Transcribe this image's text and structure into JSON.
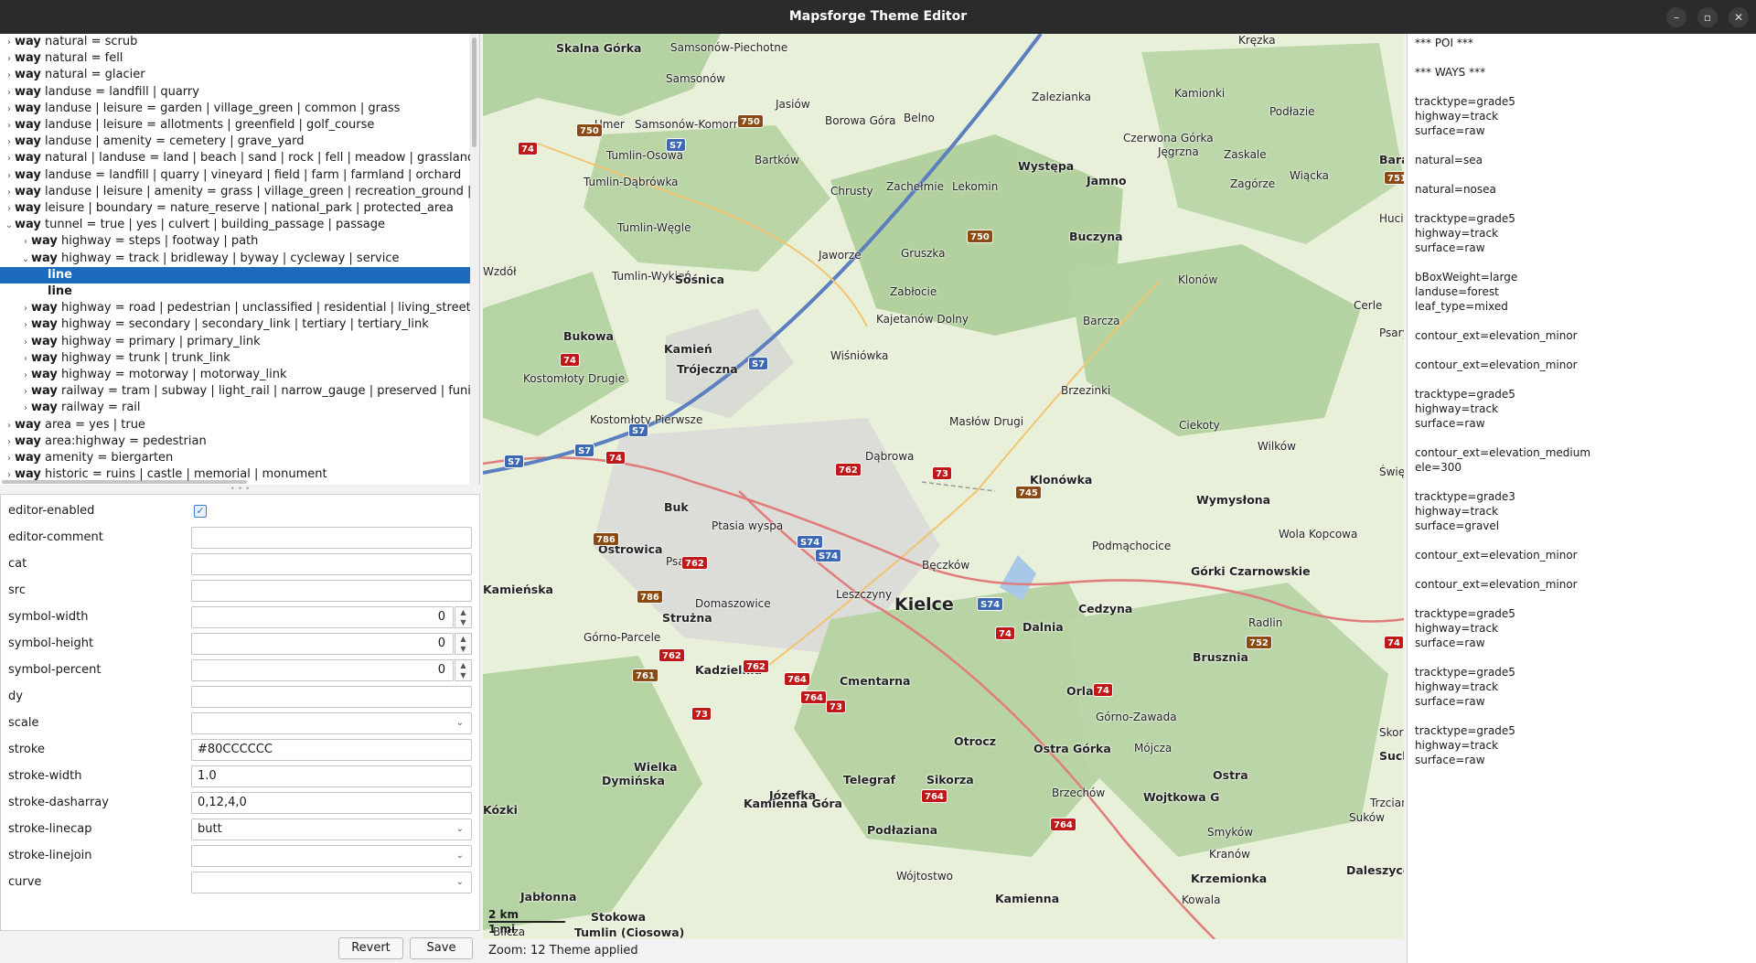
{
  "window": {
    "title": "Mapsforge Theme Editor",
    "controls": {
      "minimize": "–",
      "maximize": "▫",
      "close": "✕"
    }
  },
  "tree": {
    "rows": [
      {
        "chev": "›",
        "kw": "way",
        "text": " natural = scrub",
        "indent": 0
      },
      {
        "chev": "›",
        "kw": "way",
        "text": " natural = fell",
        "indent": 0
      },
      {
        "chev": "›",
        "kw": "way",
        "text": " natural = glacier",
        "indent": 0
      },
      {
        "chev": "›",
        "kw": "way",
        "text": " landuse = landfill | quarry",
        "indent": 0
      },
      {
        "chev": "›",
        "kw": "way",
        "text": " landuse | leisure = garden | village_green | common | grass",
        "indent": 0
      },
      {
        "chev": "›",
        "kw": "way",
        "text": " landuse | leisure = allotments | greenfield | golf_course",
        "indent": 0
      },
      {
        "chev": "›",
        "kw": "way",
        "text": " landuse | amenity = cemetery | grave_yard",
        "indent": 0
      },
      {
        "chev": "›",
        "kw": "way",
        "text": " natural | landuse = land | beach | sand | rock | fell | meadow | grassland | heath |",
        "indent": 0
      },
      {
        "chev": "›",
        "kw": "way",
        "text": " landuse = landfill | quarry | vineyard | field | farm | farmland | orchard",
        "indent": 0
      },
      {
        "chev": "›",
        "kw": "way",
        "text": " landuse | leisure | amenity = grass | village_green | recreation_ground | military |",
        "indent": 0
      },
      {
        "chev": "›",
        "kw": "way",
        "text": " leisure | boundary = nature_reserve | national_park | protected_area",
        "indent": 0
      },
      {
        "chev": "⌄",
        "kw": "way",
        "text": " tunnel = true | yes | culvert | building_passage | passage",
        "indent": 0
      },
      {
        "chev": "›",
        "kw": "way",
        "text": " highway = steps | footway | path",
        "indent": 1
      },
      {
        "chev": "⌄",
        "kw": "way",
        "text": " highway = track | bridleway | byway | cycleway | service",
        "indent": 1
      },
      {
        "chev": "",
        "kw": "line",
        "text": "",
        "indent": 2,
        "selected": true
      },
      {
        "chev": "",
        "kw": "line",
        "text": "",
        "indent": 2
      },
      {
        "chev": "›",
        "kw": "way",
        "text": " highway = road | pedestrian | unclassified | residential | living_street | construc",
        "indent": 1
      },
      {
        "chev": "›",
        "kw": "way",
        "text": " highway = secondary | secondary_link | tertiary | tertiary_link",
        "indent": 1
      },
      {
        "chev": "›",
        "kw": "way",
        "text": " highway = primary | primary_link",
        "indent": 1
      },
      {
        "chev": "›",
        "kw": "way",
        "text": " highway = trunk | trunk_link",
        "indent": 1
      },
      {
        "chev": "›",
        "kw": "way",
        "text": " highway = motorway | motorway_link",
        "indent": 1
      },
      {
        "chev": "›",
        "kw": "way",
        "text": " railway = tram | subway | light_rail | narrow_gauge | preserved | funicular | min",
        "indent": 1
      },
      {
        "chev": "›",
        "kw": "way",
        "text": " railway = rail",
        "indent": 1
      },
      {
        "chev": "›",
        "kw": "way",
        "text": " area = yes | true",
        "indent": 0
      },
      {
        "chev": "›",
        "kw": "way",
        "text": " area:highway = pedestrian",
        "indent": 0
      },
      {
        "chev": "›",
        "kw": "way",
        "text": " amenity = biergarten",
        "indent": 0
      },
      {
        "chev": "›",
        "kw": "way",
        "text": " historic = ruins | castle | memorial | monument",
        "indent": 0
      }
    ]
  },
  "props": {
    "editor_enabled": {
      "label": "editor-enabled",
      "checked": true,
      "mark": "✓"
    },
    "editor_comment": {
      "label": "editor-comment",
      "value": ""
    },
    "cat": {
      "label": "cat",
      "value": ""
    },
    "src": {
      "label": "src",
      "value": ""
    },
    "symbol_width": {
      "label": "symbol-width",
      "value": "0"
    },
    "symbol_height": {
      "label": "symbol-height",
      "value": "0"
    },
    "symbol_percent": {
      "label": "symbol-percent",
      "value": "0"
    },
    "dy": {
      "label": "dy",
      "value": ""
    },
    "scale": {
      "label": "scale",
      "value": ""
    },
    "stroke": {
      "label": "stroke",
      "value": "#80CCCCCC"
    },
    "stroke_width": {
      "label": "stroke-width",
      "value": "1.0"
    },
    "stroke_dasharray": {
      "label": "stroke-dasharray",
      "value": "0,12,4,0"
    },
    "stroke_linecap": {
      "label": "stroke-linecap",
      "value": "butt"
    },
    "stroke_linejoin": {
      "label": "stroke-linejoin",
      "value": ""
    },
    "curve": {
      "label": "curve",
      "value": ""
    }
  },
  "buttons": {
    "revert": "Revert",
    "save": "Save"
  },
  "status": {
    "text": "Zoom: 12 Theme applied"
  },
  "map": {
    "scale_km": "2 km",
    "scale_mi": "1 mi",
    "labels": [
      {
        "t": "Skalna Górka",
        "c": "town"
      },
      {
        "t": "Samsonów-Piechotne",
        "c": "village"
      },
      {
        "t": "Samsonów",
        "c": "village"
      },
      {
        "t": "Jasiów",
        "c": "village"
      },
      {
        "t": "Umer",
        "c": "village"
      },
      {
        "t": "Samsonów-Komorniki",
        "c": "village"
      },
      {
        "t": "Borowa Góra",
        "c": "village"
      },
      {
        "t": "Belno",
        "c": "village"
      },
      {
        "t": "Zalezianka",
        "c": "village"
      },
      {
        "t": "Kamionki",
        "c": "village"
      },
      {
        "t": "Kręzka",
        "c": "village"
      },
      {
        "t": "Podłazie",
        "c": "village"
      },
      {
        "t": "Czerwona Górka",
        "c": "village"
      },
      {
        "t": "Jęgrzna",
        "c": "village"
      },
      {
        "t": "Zaskale",
        "c": "village"
      },
      {
        "t": "Tumlin-Osowa",
        "c": "village"
      },
      {
        "t": "Bartków",
        "c": "village"
      },
      {
        "t": "Występa",
        "c": "town"
      },
      {
        "t": "Jamno",
        "c": "town"
      },
      {
        "t": "Zagórze",
        "c": "village"
      },
      {
        "t": "Wiącka",
        "c": "village"
      },
      {
        "t": "Tumlin-Dąbrówka",
        "c": "village"
      },
      {
        "t": "Chrusty",
        "c": "village"
      },
      {
        "t": "Zachełmie",
        "c": "village"
      },
      {
        "t": "Lekomin",
        "c": "village"
      },
      {
        "t": "Tumlin-Węgle",
        "c": "village"
      },
      {
        "t": "Buczyna",
        "c": "town"
      },
      {
        "t": "Hucisko",
        "c": "village"
      },
      {
        "t": "Jaworze",
        "c": "village"
      },
      {
        "t": "Gruszka",
        "c": "village"
      },
      {
        "t": "Tumlin-Wykień",
        "c": "village"
      },
      {
        "t": "Sośnica",
        "c": "town"
      },
      {
        "t": "Zabłocie",
        "c": "village"
      },
      {
        "t": "Kajetanów Dolny",
        "c": "village"
      },
      {
        "t": "Klonów",
        "c": "village"
      },
      {
        "t": "Cerle",
        "c": "village"
      },
      {
        "t": "Psary-",
        "c": "village"
      },
      {
        "t": "Barcza",
        "c": "village"
      },
      {
        "t": "Bukowa",
        "c": "town"
      },
      {
        "t": "Kamień",
        "c": "town"
      },
      {
        "t": "Trójeczna",
        "c": "town"
      },
      {
        "t": "Wiśniówka",
        "c": "village"
      },
      {
        "t": "Kostomłoty Drugie",
        "c": "village"
      },
      {
        "t": "Brzezinki",
        "c": "village"
      },
      {
        "t": "Kostomłoty Pierwsze",
        "c": "village"
      },
      {
        "t": "Masłów Drugi",
        "c": "village"
      },
      {
        "t": "Ciekoty",
        "c": "village"
      },
      {
        "t": "Wilków",
        "c": "village"
      },
      {
        "t": "Dąbrowa",
        "c": "village"
      },
      {
        "t": "Klonówka",
        "c": "town"
      },
      {
        "t": "Święta K",
        "c": "village"
      },
      {
        "t": "Buk",
        "c": "town"
      },
      {
        "t": "Ptasia wyspa",
        "c": "village"
      },
      {
        "t": "Podmąchocice",
        "c": "village"
      },
      {
        "t": "Wymysłona",
        "c": "town"
      },
      {
        "t": "Wola Kopcowa",
        "c": "village"
      },
      {
        "t": "Bęczków",
        "c": "village"
      },
      {
        "t": "Górki Czarnowskie",
        "c": "town"
      },
      {
        "t": "Domaszowice",
        "c": "village"
      },
      {
        "t": "Leszczyny",
        "c": "village"
      },
      {
        "t": "Kielce",
        "c": "city"
      },
      {
        "t": "Cedzyna",
        "c": "town"
      },
      {
        "t": "Strużna",
        "c": "town"
      },
      {
        "t": "Dalnia",
        "c": "town"
      },
      {
        "t": "Radlin",
        "c": "village"
      },
      {
        "t": "Górno-Parcele",
        "c": "village"
      },
      {
        "t": "Brusznia",
        "c": "town"
      },
      {
        "t": "Kadzielnia",
        "c": "town"
      },
      {
        "t": "Cmentarna",
        "c": "town"
      },
      {
        "t": "Górno-Zawada",
        "c": "village"
      },
      {
        "t": "Ostra Górka",
        "c": "town"
      },
      {
        "t": "Otrocz",
        "c": "town"
      },
      {
        "t": "Mójcza",
        "c": "village"
      },
      {
        "t": "Orla",
        "c": "town"
      },
      {
        "t": "Wielka",
        "c": "town"
      },
      {
        "t": "Telegraf",
        "c": "town"
      },
      {
        "t": "Józefka",
        "c": "town"
      },
      {
        "t": "Ostra",
        "c": "town"
      },
      {
        "t": "Dymińska",
        "c": "town"
      },
      {
        "t": "Kamienna Góra",
        "c": "town"
      },
      {
        "t": "Sikorza",
        "c": "town"
      },
      {
        "t": "Brzechów",
        "c": "village"
      },
      {
        "t": "Wojtkowa G",
        "c": "town"
      },
      {
        "t": "Trzcianki",
        "c": "village"
      },
      {
        "t": "Kózki",
        "c": "town"
      },
      {
        "t": "Smyków",
        "c": "village"
      },
      {
        "t": "Suków",
        "c": "village"
      },
      {
        "t": "Podłazianа",
        "c": "town"
      },
      {
        "t": "Kranów",
        "c": "village"
      },
      {
        "t": "Wójtostwo",
        "c": "village"
      },
      {
        "t": "Krzemionka",
        "c": "town"
      },
      {
        "t": "Daleszyce",
        "c": "town"
      },
      {
        "t": "Kowala",
        "c": "village"
      },
      {
        "t": "Jabłonna",
        "c": "town"
      },
      {
        "t": "Kamienna",
        "c": "town"
      },
      {
        "t": "Stokowa",
        "c": "town"
      },
      {
        "t": "Bilcza",
        "c": "village"
      },
      {
        "t": "Tumlin (Ciosowa)",
        "c": "town"
      },
      {
        "t": "Wzdół",
        "c": "village"
      },
      {
        "t": "Bara",
        "c": "town"
      },
      {
        "t": "Skorze",
        "c": "village"
      },
      {
        "t": "Suchowica",
        "c": "town"
      },
      {
        "t": "Ostrowica",
        "c": "town"
      },
      {
        "t": "Kamieńska",
        "c": "town"
      },
      {
        "t": "Psary",
        "c": "village"
      }
    ],
    "shields": [
      {
        "t": "750",
        "c": "brown"
      },
      {
        "t": "750",
        "c": "brown"
      },
      {
        "t": "750",
        "c": "brown"
      },
      {
        "t": "751",
        "c": "brown"
      },
      {
        "t": "74",
        "c": "red"
      },
      {
        "t": "74",
        "c": "red"
      },
      {
        "t": "74",
        "c": "red"
      },
      {
        "t": "762",
        "c": "red"
      },
      {
        "t": "762",
        "c": "red"
      },
      {
        "t": "762",
        "c": "red"
      },
      {
        "t": "762",
        "c": "red"
      },
      {
        "t": "73",
        "c": "red"
      },
      {
        "t": "73",
        "c": "red"
      },
      {
        "t": "73",
        "c": "red"
      },
      {
        "t": "764",
        "c": "red"
      },
      {
        "t": "764",
        "c": "red"
      },
      {
        "t": "764",
        "c": "red"
      },
      {
        "t": "764",
        "c": "red"
      },
      {
        "t": "745",
        "c": "brown"
      },
      {
        "t": "786",
        "c": "brown"
      },
      {
        "t": "786",
        "c": "brown"
      },
      {
        "t": "761",
        "c": "brown"
      },
      {
        "t": "752",
        "c": "brown"
      },
      {
        "t": "74",
        "c": "red"
      },
      {
        "t": "74",
        "c": "red"
      },
      {
        "t": "74",
        "c": "red"
      },
      {
        "t": "S7",
        "c": "blue"
      },
      {
        "t": "S7",
        "c": "blue"
      },
      {
        "t": "S7",
        "c": "blue"
      },
      {
        "t": "S7",
        "c": "blue"
      },
      {
        "t": "S7",
        "c": "blue"
      },
      {
        "t": "S74",
        "c": "blue"
      },
      {
        "t": "S74",
        "c": "blue"
      },
      {
        "t": "S74",
        "c": "blue"
      }
    ]
  },
  "right_panel": {
    "lines": [
      "*** POI ***",
      "",
      "*** WAYS ***",
      "",
      "tracktype=grade5",
      "highway=track",
      "surface=raw",
      "",
      "natural=sea",
      "",
      "natural=nosea",
      "",
      "tracktype=grade5",
      "highway=track",
      "surface=raw",
      "",
      "bBoxWeight=large",
      "landuse=forest",
      "leaf_type=mixed",
      "",
      "contour_ext=elevation_minor",
      "",
      "contour_ext=elevation_minor",
      "",
      "tracktype=grade5",
      "highway=track",
      "surface=raw",
      "",
      "contour_ext=elevation_medium",
      "ele=300",
      "",
      "tracktype=grade3",
      "highway=track",
      "surface=gravel",
      "",
      "contour_ext=elevation_minor",
      "",
      "contour_ext=elevation_minor",
      "",
      "tracktype=grade5",
      "highway=track",
      "surface=raw",
      "",
      "tracktype=grade5",
      "highway=track",
      "surface=raw",
      "",
      "tracktype=grade5",
      "highway=track",
      "surface=raw"
    ]
  }
}
